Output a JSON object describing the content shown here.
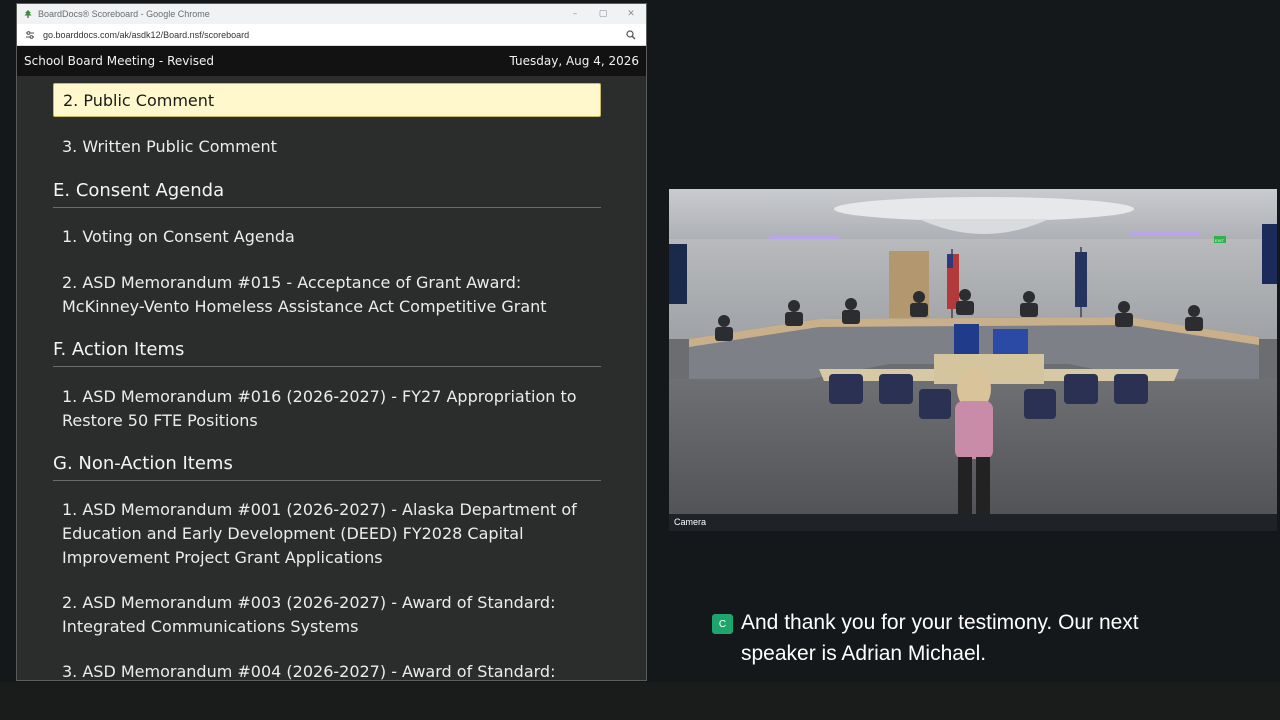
{
  "browser": {
    "window_title": "BoardDocs® Scoreboard - Google Chrome",
    "url": "go.boarddocs.com/ak/asdk12/Board.nsf/scoreboard",
    "controls": {
      "minimize": "–",
      "maximize": "▢",
      "close": "✕"
    }
  },
  "header": {
    "meeting_title": "School Board Meeting - Revised",
    "date": "Tuesday, Aug 4, 2026"
  },
  "agenda": {
    "active_item": "2. Public Comment",
    "written_comment": "3. Written Public Comment",
    "sections": {
      "e": "E. Consent Agenda",
      "f": "F. Action Items",
      "g": "G. Non-Action Items"
    },
    "items": {
      "e1": "1. Voting on Consent Agenda",
      "e2_line1": "2. ASD Memorandum #015 - Acceptance of Grant Award:",
      "e2_line2": "McKinney-Vento Homeless Assistance Act Competitive Grant",
      "f1_line1": "1. ASD Memorandum #016 (2026-2027) - FY27 Appropriation to",
      "f1_line2": "Restore 50 FTE Positions",
      "g1_line1": "1. ASD Memorandum #001 (2026-2027) - Alaska Department of",
      "g1_line2": "Education and Early Development (DEED) FY2028 Capital",
      "g1_line3": "Improvement Project Grant Applications",
      "g2_line1": "2. ASD Memorandum #003 (2026-2027) - Award of Standard:",
      "g2_line2": "Integrated Communications Systems",
      "g3_line1": "3. ASD Memorandum #004 (2026-2027) - Award of Standard:"
    }
  },
  "video": {
    "camera_label": "Camera",
    "exit_sign": "EXIT"
  },
  "caption": {
    "badge": "C",
    "text_line1": "And thank you for your testimony. Our next",
    "text_line2": "speaker is Adrian Michael."
  },
  "colors": {
    "active_item_bg": "#fff8cc",
    "caption_badge": "#1ea56e",
    "page_bg": "#14181a"
  },
  "icons": [
    "boarddocs-logo-icon",
    "site-info-icon",
    "zoom-icon"
  ]
}
